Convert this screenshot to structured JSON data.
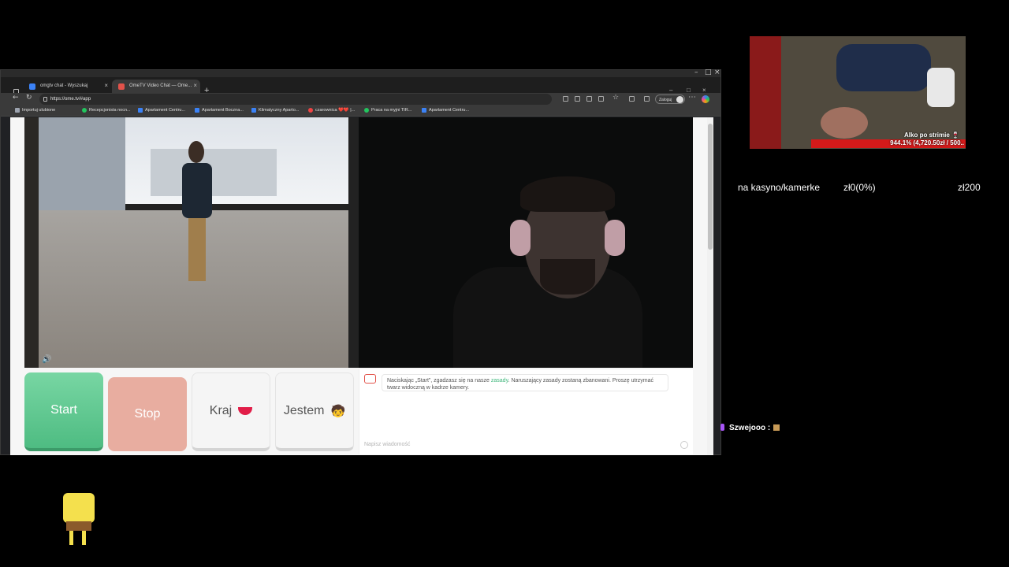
{
  "browser": {
    "tabs": [
      {
        "label": "omgtv chat - Wyszukaj"
      },
      {
        "label": "OmeTV Video Chat — Ome..."
      }
    ],
    "url": "https://ome.tv/#app",
    "login_label": "Zaloguj",
    "bookmarks": [
      {
        "label": "Importuj ulubione",
        "color": "#9ca3af"
      },
      {
        "label": "Recepcjonista nocn...",
        "color": "#22c55e"
      },
      {
        "label": "Apartament Centru...",
        "color": "#3b82f6"
      },
      {
        "label": "Apartament Boczna...",
        "color": "#3b82f6"
      },
      {
        "label": "Klimatyczny Aparto...",
        "color": "#3b82f6"
      },
      {
        "label": "czarownica ❤️❤️ |...",
        "color": "#ef4444"
      },
      {
        "label": "Praca na myjni TIR...",
        "color": "#22c55e"
      },
      {
        "label": "Apartament Centru...",
        "color": "#3b82f6"
      }
    ]
  },
  "page": {
    "buttons": {
      "start": "Start",
      "stop": "Stop",
      "country": "Kraj",
      "gender": "Jestem"
    },
    "chat": {
      "notice_before": "Naciskając „Start”, zgadzasz się na nasze ",
      "notice_link": "zasady",
      "notice_after": ". Naruszający zasady zostaną zbanowani. Proszę utrzymać twarz widoczną w kadrze kamery.",
      "input_placeholder": "Napisz wiadomość"
    }
  },
  "overlay": {
    "cam_caption": "Alko po strimie 🍷",
    "goal_text": "944.1% (4,720.50zł / 500..",
    "stats": {
      "label": "na kasyno/kamerke",
      "current": "zł0(0%)",
      "target": "zł200"
    },
    "chat": {
      "username": "Szwejooo",
      "separator": ":"
    }
  },
  "colors": {
    "start": "#4ebc82",
    "stop": "#e8ada0",
    "link": "#3eb67b",
    "goal_bar": "#d31a1a"
  }
}
